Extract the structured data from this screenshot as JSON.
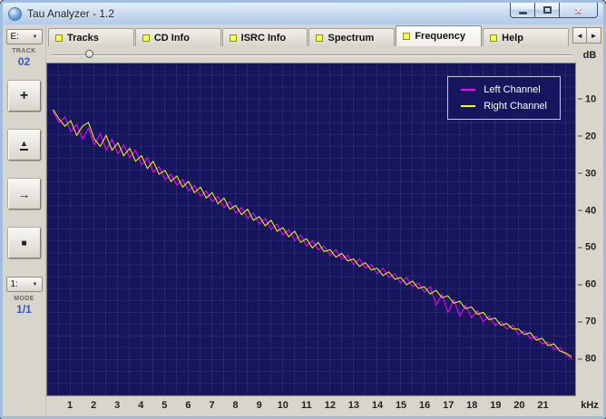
{
  "window": {
    "title": "Tau Analyzer - 1.2"
  },
  "colors": {
    "tab_led": "#f6ff5c",
    "chart_bg": "#16165e",
    "left_channel": "#ff00ff",
    "right_channel": "#ffff00"
  },
  "tabs": [
    {
      "label": "Tracks"
    },
    {
      "label": "CD Info"
    },
    {
      "label": "ISRC Info"
    },
    {
      "label": "Spectrum"
    },
    {
      "label": "Frequency",
      "active": true
    },
    {
      "label": "Help"
    }
  ],
  "tab_scroll": {
    "left": "◄",
    "right": "►"
  },
  "sidebar": {
    "drive_value": "E:",
    "drive_arrow": "▼",
    "track_label": "TRACK",
    "track_value": "02",
    "buttons": [
      {
        "name": "plus",
        "glyph": "+"
      },
      {
        "name": "eject",
        "glyph": "▲"
      },
      {
        "name": "next",
        "glyph": "→"
      },
      {
        "name": "stop",
        "glyph": "■"
      }
    ],
    "mode_drive_value": "1:",
    "mode_arrow": "▼",
    "mode_label": "MODE",
    "mode_value": "1/1"
  },
  "slider": {
    "position_percent": 6.5
  },
  "chart_data": {
    "type": "line",
    "title": "",
    "xlabel": "kHz",
    "ylabel": "dB",
    "grid": true,
    "legend_position": "top-right",
    "xlim": [
      0,
      22.4
    ],
    "ylim": [
      -90,
      0
    ],
    "x_ticks": [
      1,
      2,
      3,
      4,
      5,
      6,
      7,
      8,
      9,
      10,
      11,
      12,
      13,
      14,
      15,
      16,
      17,
      18,
      19,
      20,
      21
    ],
    "y_ticks": [
      10,
      20,
      30,
      40,
      50,
      60,
      70,
      80
    ],
    "x": [
      0.25,
      0.5,
      0.75,
      1,
      1.25,
      1.5,
      1.75,
      2,
      2.25,
      2.5,
      2.75,
      3,
      3.25,
      3.5,
      3.75,
      4,
      4.25,
      4.5,
      4.75,
      5,
      5.25,
      5.5,
      5.75,
      6,
      6.25,
      6.5,
      6.75,
      7,
      7.25,
      7.5,
      7.75,
      8,
      8.25,
      8.5,
      8.75,
      9,
      9.25,
      9.5,
      9.75,
      10,
      10.25,
      10.5,
      10.75,
      11,
      11.25,
      11.5,
      11.75,
      12,
      12.25,
      12.5,
      12.75,
      13,
      13.25,
      13.5,
      13.75,
      14,
      14.25,
      14.5,
      14.75,
      15,
      15.25,
      15.5,
      15.75,
      16,
      16.25,
      16.5,
      16.75,
      17,
      17.25,
      17.5,
      17.75,
      18,
      18.25,
      18.5,
      18.75,
      19,
      19.25,
      19.5,
      19.75,
      20,
      20.25,
      20.5,
      20.75,
      21,
      21.25,
      21.5,
      21.75,
      22,
      22.25
    ],
    "series": [
      {
        "name": "Left Channel",
        "color": "#ff00ff",
        "values": [
          -13,
          -16,
          -14.5,
          -18.5,
          -16.5,
          -20.5,
          -17.5,
          -22,
          -19,
          -23.5,
          -20.5,
          -24.5,
          -22,
          -25.5,
          -23.5,
          -27.5,
          -25.5,
          -29.5,
          -28,
          -31.5,
          -30,
          -33,
          -31.5,
          -34.5,
          -33,
          -36,
          -34.5,
          -37.5,
          -36,
          -39,
          -37.5,
          -40.5,
          -39,
          -42,
          -40.5,
          -43.5,
          -42,
          -45,
          -43.5,
          -46.5,
          -45,
          -48,
          -46.5,
          -49.5,
          -48,
          -50.5,
          -49.5,
          -52,
          -50.5,
          -53,
          -52,
          -54.5,
          -53,
          -55.5,
          -54.5,
          -57,
          -55.5,
          -58,
          -57,
          -59.5,
          -58,
          -60.5,
          -59.5,
          -62,
          -60.5,
          -65.5,
          -62.5,
          -67.5,
          -64,
          -68.5,
          -65.5,
          -69,
          -67,
          -70,
          -68.5,
          -71,
          -70,
          -72,
          -71,
          -73.5,
          -72.5,
          -74.5,
          -74,
          -76,
          -75.5,
          -77.5,
          -77,
          -79,
          -80
        ]
      },
      {
        "name": "Right Channel",
        "color": "#ffff00",
        "values": [
          -12.5,
          -15,
          -17,
          -15.5,
          -19.5,
          -17,
          -16,
          -20.5,
          -22.5,
          -19.5,
          -23.5,
          -21.5,
          -25,
          -23,
          -26.5,
          -25,
          -28.5,
          -26.5,
          -30,
          -29,
          -32,
          -30.5,
          -33.5,
          -32,
          -35,
          -33.5,
          -36.5,
          -35,
          -38,
          -36.5,
          -39.5,
          -38.5,
          -41,
          -39.5,
          -42.5,
          -41.5,
          -44,
          -42.5,
          -45.5,
          -44.5,
          -47,
          -45.5,
          -48.5,
          -47.5,
          -50,
          -48.5,
          -51,
          -50.5,
          -52.5,
          -51.5,
          -53.5,
          -53,
          -55,
          -54,
          -56,
          -55.5,
          -57.5,
          -56.5,
          -58.5,
          -58,
          -60,
          -59,
          -61,
          -60.5,
          -62.5,
          -61.5,
          -63.5,
          -63,
          -65,
          -64.5,
          -66.5,
          -66,
          -68,
          -67.5,
          -69.5,
          -69,
          -71,
          -70.5,
          -72,
          -72,
          -73.5,
          -73,
          -75,
          -74.5,
          -76.5,
          -76,
          -78,
          -78.5,
          -79.5
        ]
      }
    ]
  }
}
